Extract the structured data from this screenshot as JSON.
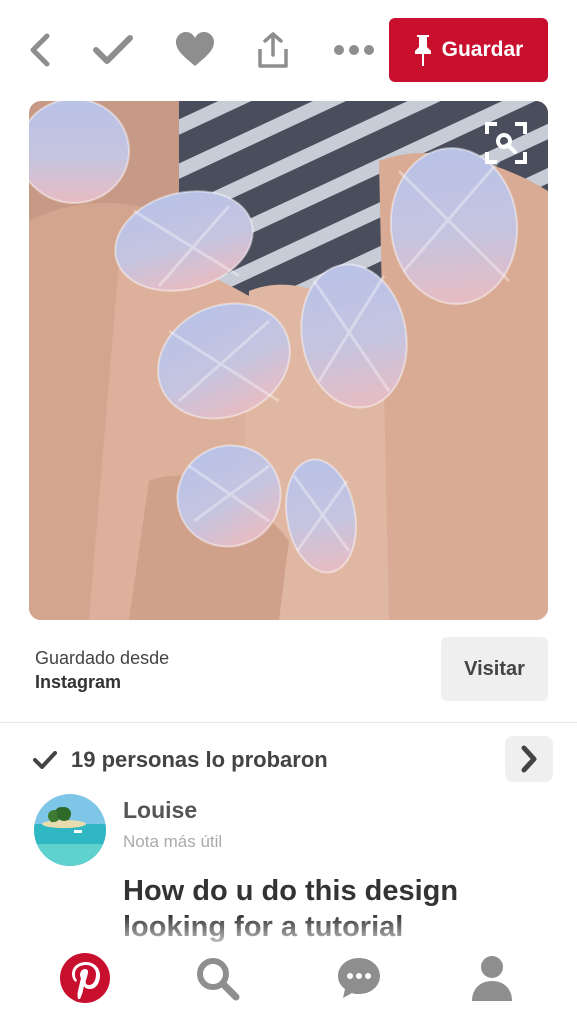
{
  "toolbar": {
    "back_icon": "chevron-left-icon",
    "tried_icon": "checkmark-icon",
    "like_icon": "heart-icon",
    "share_icon": "share-icon",
    "more_icon": "more-dots-icon",
    "save_label": "Guardar",
    "save_color": "#c8102e"
  },
  "pin": {
    "zoom_icon": "visual-search-icon"
  },
  "source": {
    "label": "Guardado desde",
    "name": "Instagram",
    "visit_label": "Visitar"
  },
  "tried": {
    "text": "19 personas lo probaron"
  },
  "comment": {
    "author": "Louise",
    "meta": "Nota más útil",
    "text": "How do u do this design looking for a tutorial"
  },
  "bottom_nav": {
    "items": [
      "home-pinterest-icon",
      "search-icon",
      "messages-icon",
      "profile-icon"
    ],
    "active_color": "#c8102e",
    "inactive_color": "#8e8e8e"
  }
}
